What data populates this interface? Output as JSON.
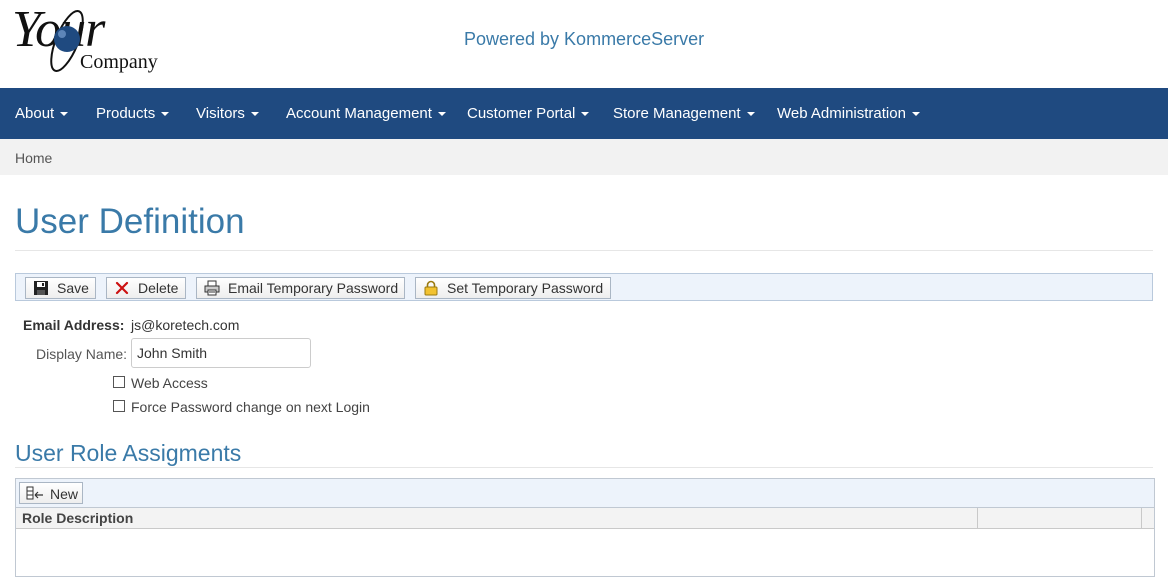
{
  "header": {
    "logo_text": "Your",
    "logo_sub": "Company",
    "powered_by": "Powered by KommerceServer"
  },
  "nav": {
    "items": [
      {
        "label": "About"
      },
      {
        "label": "Products"
      },
      {
        "label": "Visitors"
      },
      {
        "label": "Account Management"
      },
      {
        "label": "Customer Portal"
      },
      {
        "label": "Store Management"
      },
      {
        "label": "Web Administration"
      }
    ]
  },
  "breadcrumb": {
    "home": "Home"
  },
  "page": {
    "title": "User Definition"
  },
  "toolbar": {
    "save": "Save",
    "delete": "Delete",
    "email_temp_password": "Email Temporary Password",
    "set_temp_password": "Set Temporary Password"
  },
  "form": {
    "email_label": "Email Address:",
    "email_value": "js@koretech.com",
    "display_name_label": "Display Name:",
    "display_name_value": "John Smith",
    "web_access_label": "Web Access",
    "web_access_checked": false,
    "force_pw_label": "Force Password change on next Login",
    "force_pw_checked": false
  },
  "roles": {
    "title": "User Role Assigments",
    "new_label": "New",
    "column_role": "Role Description",
    "rows": []
  },
  "colors": {
    "navbar": "#1f4a80",
    "accent": "#3a7aa8",
    "breadcrumb_bg": "#f2f2f2",
    "toolbar_bg": "#edf3fb"
  }
}
